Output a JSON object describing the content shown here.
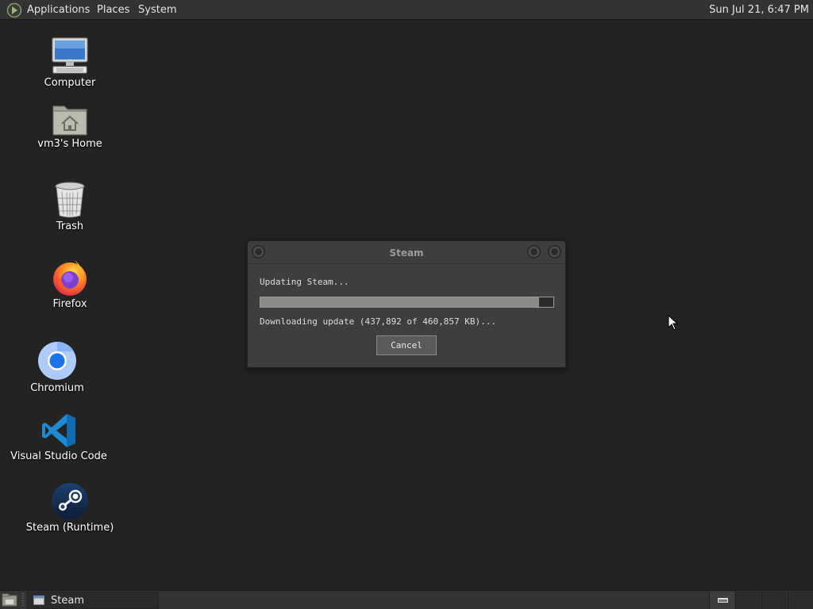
{
  "top_panel": {
    "menus": [
      "Applications",
      "Places",
      "System"
    ],
    "clock": "Sun Jul 21,  6:47 PM"
  },
  "desktop": {
    "icons": [
      {
        "label": "Computer",
        "icon": "computer-icon"
      },
      {
        "label": "vm3's Home",
        "icon": "home-folder-icon"
      },
      {
        "label": "Trash",
        "icon": "trash-icon"
      },
      {
        "label": "Firefox",
        "icon": "firefox-icon"
      },
      {
        "label": "Chromium",
        "icon": "chromium-icon"
      },
      {
        "label": "Visual Studio Code",
        "icon": "vscode-icon"
      },
      {
        "label": "Steam (Runtime)",
        "icon": "steam-icon"
      }
    ]
  },
  "dialog": {
    "title": "Steam",
    "status": "Updating Steam...",
    "progress": 0.95,
    "detail": "Downloading update (437,892 of 460,857 KB)...",
    "cancel_label": "Cancel"
  },
  "bottom_panel": {
    "tasks": [
      {
        "label": "Steam",
        "icon": "window-icon"
      }
    ],
    "workspaces": 4,
    "active_workspace": 1
  },
  "colors": {
    "desktop_bg": "#232323",
    "panel_bg": "#333333",
    "dialog_bg": "#3e3e3e",
    "progress_fill": "#8a8a86"
  }
}
